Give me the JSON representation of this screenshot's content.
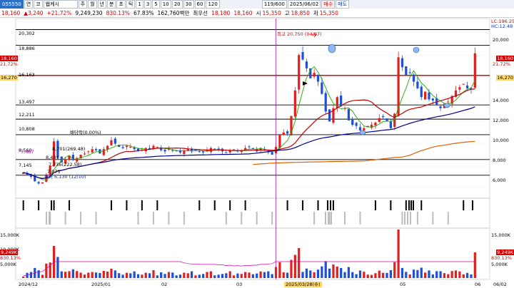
{
  "toolbar": {
    "code": "055550",
    "mode": "연",
    "name_prefix": "코",
    "name": "웹케시",
    "period_buttons": [
      "주",
      "월",
      "년",
      "분",
      "초",
      "틱"
    ],
    "minute_buttons": [
      "1",
      "3",
      "5",
      "10",
      "20",
      "30",
      "60",
      "120"
    ],
    "bar_count": "119/600",
    "date": "2025/06/02",
    "buy": "매수",
    "sell": "매도"
  },
  "quote": {
    "price": "18,160",
    "change": "▲3,240",
    "change_pct": "+21.72%",
    "volume": "9,249,230",
    "vol_ratio": "830.13%",
    "turnover": "67.83%",
    "amount": "162,760백만",
    "priority": "최우선",
    "ask": "18,180",
    "bid": "18,160",
    "open_label": "시",
    "open": "15,350",
    "high_label": "고",
    "high": "18,850",
    "low_label": "저",
    "low": "15,350"
  },
  "price_levels": [
    "20,302",
    "18,886",
    "16,163",
    "13,497",
    "12,211",
    "10,808",
    "8,560",
    "7,145"
  ],
  "annotations": {
    "high": "최고 20,750 (04/07)",
    "low": "최저 6,130 (12/10)",
    "dividend": "배당락(0.00%)",
    "a1": "8,701(269.48)",
    "a2": "8,431",
    "a3": "7,736(222.58)",
    "a4": "7,075",
    "a5": "7,467"
  },
  "right_axis": {
    "price_ticks": [
      "20,000",
      "18,000",
      "16,000",
      "14,000",
      "12,000",
      "10,000",
      "8,000",
      "6,000"
    ],
    "vol_ticks": [
      "15,000K",
      "10,000K",
      "5,000K"
    ],
    "lc": "LC:196.25",
    "hc": "HC:12.48",
    "price_tag": "18,160",
    "pct_tag": "21.72%",
    "level_tag": "16,270",
    "vol_tag": "9,249K",
    "vol_pct_tag": "830.13%"
  },
  "left_axis": {
    "price_tag": "18,160",
    "pct_tag": "21.72%",
    "level_tag": "16,270",
    "vol_ticks": [
      "15,000K",
      "10,000K",
      "5,000K"
    ],
    "vol_tag": "9,249K",
    "vol_pct_tag": "830.13%"
  },
  "xaxis": [
    "2024/12",
    "2025/01",
    "02",
    "03",
    "2025/03/28(수)",
    "05",
    "06",
    "06/02"
  ],
  "colors": {
    "up": "#e02020",
    "down": "#1d4fd8",
    "ma5": "#1faa00",
    "ma20": "#c00000",
    "ma60": "#00008b",
    "ma120": "#e06000",
    "level": "#000000",
    "cursor": "#b000b0"
  },
  "chart_data": {
    "type": "candlestick",
    "ylim": [
      5200,
      21300
    ],
    "closes": [
      7400,
      7200,
      7000,
      6600,
      6400,
      6500,
      7200,
      8000,
      10200,
      8700,
      8300,
      8600,
      8900,
      8500,
      8700,
      9000,
      9100,
      9300,
      9500,
      9400,
      9100,
      9500,
      9800,
      10300,
      10000,
      9700,
      9600,
      9800,
      9700,
      9500,
      9300,
      9400,
      9600,
      9500,
      9800,
      9700,
      9400,
      9300,
      9500,
      9400,
      9300,
      9200,
      9400,
      9500,
      9300,
      9400,
      9300,
      9200,
      9400,
      9600,
      9500,
      9400,
      9300,
      9200,
      9400,
      9500,
      9300,
      9400,
      9600,
      9700,
      9500,
      9300,
      9600,
      9400,
      9200,
      9000,
      9700,
      10800,
      11000,
      10900,
      12500,
      14800,
      18000,
      17600,
      16800,
      15900,
      16400,
      15600,
      14500,
      12900,
      12000,
      13200,
      14200,
      13400,
      13200,
      12100,
      11700,
      11600,
      11200,
      11400,
      11600,
      11700,
      11900,
      12300,
      12400,
      12000,
      11400,
      12700,
      17800,
      16900,
      16200,
      16400,
      15600,
      15000,
      14200,
      14700,
      14000,
      13900,
      13500,
      13200,
      13600,
      13800,
      14300,
      14800,
      15100,
      15400,
      15000,
      14900,
      18160
    ]
  }
}
